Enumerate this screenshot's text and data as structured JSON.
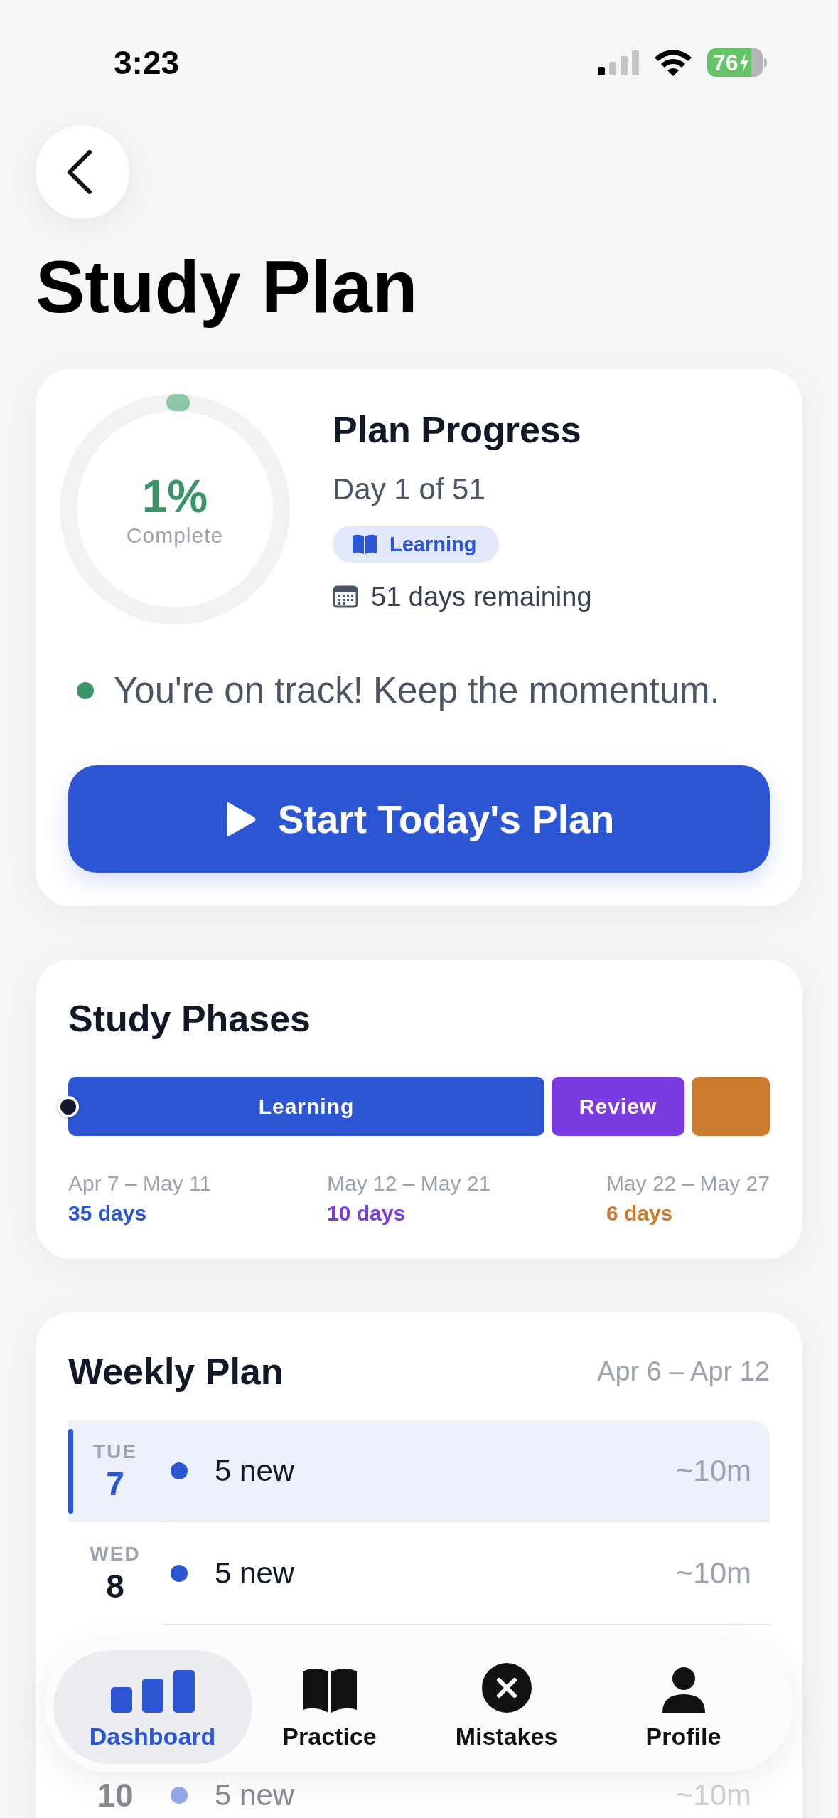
{
  "status_bar": {
    "time": "3:23",
    "battery": "76"
  },
  "header": {
    "title": "Study Plan"
  },
  "progress": {
    "level": 0.01,
    "percent": "1%",
    "caption": "Complete",
    "title": "Plan Progress",
    "day": "Day 1 of 51",
    "phase_badge": "Learning",
    "remaining": "51 days remaining",
    "status": {
      "text": "You're on track! Keep the momentum.",
      "color": "#3a9467"
    },
    "button": "Start Today's Plan"
  },
  "phases": {
    "title": "Study Phases",
    "items": [
      {
        "name": "Learning",
        "color": "#2c55d4",
        "current": true,
        "dates": "Apr 7 – May 11",
        "days": "35 days"
      },
      {
        "name": "Review",
        "color": "#7a3be0",
        "current": false,
        "dates": "May 12 – May 21",
        "days": "10 days"
      },
      {
        "color": "#cc7a2e",
        "current": false,
        "dates": "May 22 – May 27",
        "days": "6 days"
      }
    ]
  },
  "weekly": {
    "title": "Weekly Plan",
    "range": "Apr 6 – Apr 12",
    "rows": [
      {
        "day": "TUE",
        "date": "7",
        "selected": true,
        "faded": false,
        "task": "5 new",
        "duration": "~10m"
      },
      {
        "day": "WED",
        "date": "8",
        "selected": false,
        "faded": false,
        "task": "5 new",
        "duration": "~10m"
      },
      {
        "date": "10",
        "selected": false,
        "faded": true,
        "task": "5 new",
        "duration": "~10m"
      }
    ]
  },
  "tab_bar": {
    "items": [
      {
        "kind": "chart",
        "label": "Dashboard",
        "selected": true
      },
      {
        "kind": "book",
        "label": "Practice",
        "selected": false
      },
      {
        "kind": "mistakes",
        "label": "Mistakes",
        "selected": false
      },
      {
        "kind": "person",
        "label": "Profile",
        "selected": false
      }
    ]
  }
}
